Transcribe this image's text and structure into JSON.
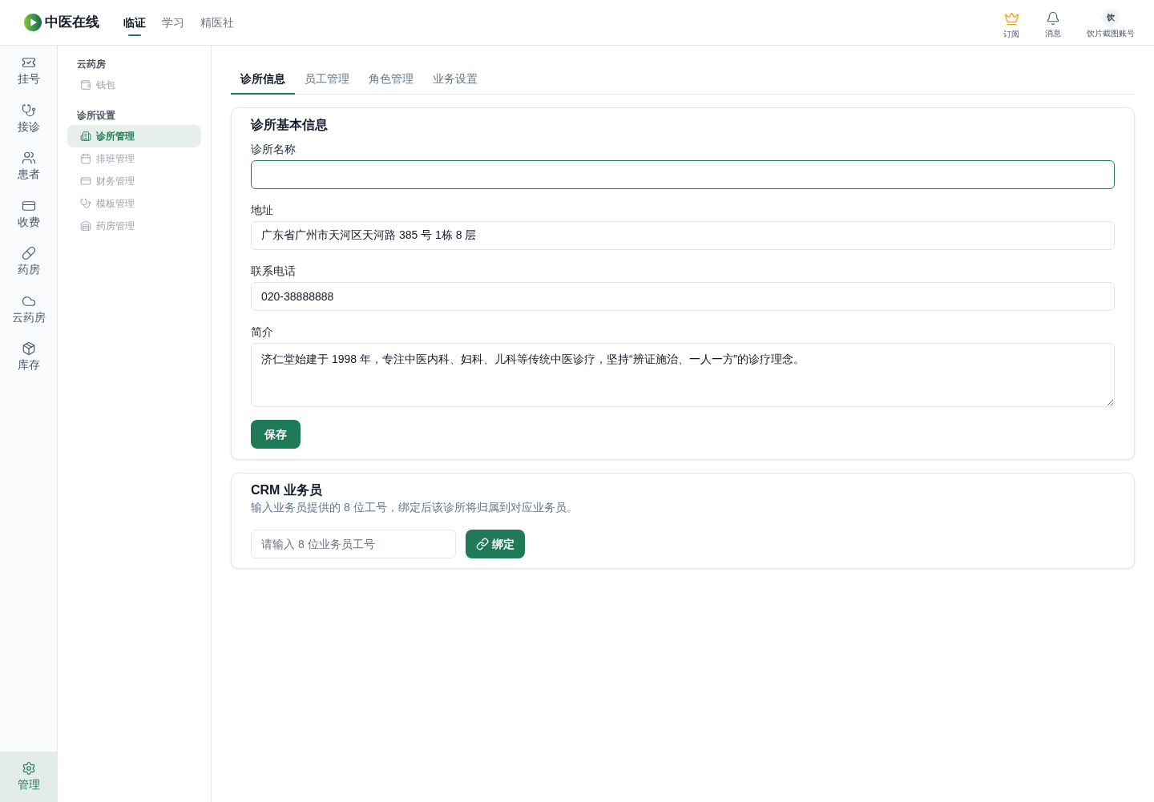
{
  "header": {
    "logo": {
      "text": "中医在线"
    },
    "nav": [
      {
        "label": "临证",
        "selected": true
      },
      {
        "label": "学习",
        "selected": false
      },
      {
        "label": "精医社",
        "selected": false
      }
    ],
    "actions": [
      {
        "kind": "subscribe",
        "label": "订阅"
      },
      {
        "kind": "messages",
        "label": "消息"
      }
    ],
    "account": {
      "avatar_text": "饮",
      "name": "饮片截图账号"
    }
  },
  "rail": {
    "items": [
      {
        "kind": "ticket",
        "label": "挂号",
        "selected": false
      },
      {
        "kind": "stethoscope",
        "label": "接诊",
        "selected": false
      },
      {
        "kind": "users",
        "label": "患者",
        "selected": false
      },
      {
        "kind": "card",
        "label": "收费",
        "selected": false
      },
      {
        "kind": "pill",
        "label": "药房",
        "selected": false
      },
      {
        "kind": "cloud",
        "label": "云药房",
        "selected": false
      },
      {
        "kind": "package",
        "label": "库存",
        "selected": false
      }
    ],
    "footer_item": {
      "kind": "gear",
      "label": "管理",
      "selected": true
    }
  },
  "sidebar": {
    "sections": [
      {
        "title": "云药房",
        "items": [
          {
            "kind": "wallet",
            "label": "钱包",
            "selected": false
          }
        ]
      },
      {
        "title": "诊所设置",
        "items": [
          {
            "kind": "building",
            "label": "诊所管理",
            "selected": true
          },
          {
            "kind": "calendar",
            "label": "排班管理",
            "selected": false
          },
          {
            "kind": "card",
            "label": "财务管理",
            "selected": false
          },
          {
            "kind": "stethoscope",
            "label": "模板管理",
            "selected": false
          },
          {
            "kind": "warehouse",
            "label": "药房管理",
            "selected": false
          }
        ]
      }
    ]
  },
  "tabs": [
    {
      "label": "诊所信息",
      "selected": true
    },
    {
      "label": "员工管理",
      "selected": false
    },
    {
      "label": "角色管理",
      "selected": false
    },
    {
      "label": "业务设置",
      "selected": false
    }
  ],
  "clinic_form": {
    "title": "诊所基本信息",
    "fields": [
      {
        "kind": "text",
        "label": "诊所名称",
        "focused": true
      },
      {
        "kind": "text",
        "label": "地址",
        "value": "广东省广州市天河区天河路 385 号 1栋 8 层",
        "focused": false
      },
      {
        "kind": "text",
        "label": "联系电话",
        "value": "020-38888888",
        "focused": false
      },
      {
        "kind": "textarea",
        "label": "简介",
        "value": "济仁堂始建于 1998 年，专注中医内科、妇科、儿科等传统中医诊疗，坚持“辨证施治、一人一方”的诊疗理念。",
        "focused": false
      }
    ],
    "save_button": "保存"
  },
  "crm": {
    "title": "CRM 业务员",
    "description": "输入业务员提供的 8 位工号，绑定后该诊所将归属到对应业务员。",
    "input": {
      "placeholder": "请输入 8 位业务员工号"
    },
    "bind_button": "绑定"
  }
}
